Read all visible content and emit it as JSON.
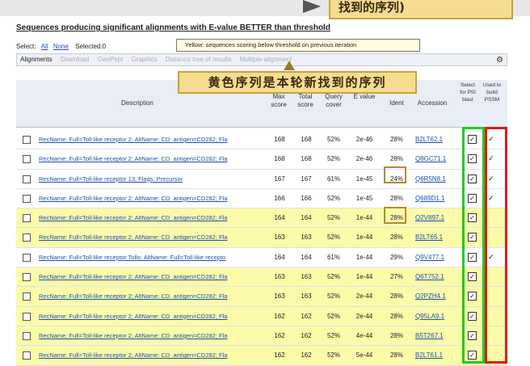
{
  "callout_top": "找到的序列)",
  "section_title": "Sequences producing significant alignments with E-value BETTER than threshold",
  "select": {
    "label": "Select:",
    "all": "All",
    "none": "None",
    "selected": "Selected:0"
  },
  "yellow_note": "Yellow: sequences scoring below threshold on previous iteration",
  "toolbar": {
    "alignments": "Alignments",
    "download": "Download",
    "genpept": "GenPept",
    "graphics": "Graphics",
    "distance": "Distance tree of results",
    "multiple": "Multiple alignment"
  },
  "callout_mid": "黄色序列是本轮新找到的序列",
  "headers": {
    "description": "Description",
    "max_score": "Max score",
    "total_score": "Total score",
    "query_cover": "Query cover",
    "e_value": "E value",
    "ident": "Ident",
    "accession": "Accession",
    "select_psi": "Select for PSI blast",
    "used_pssm": "Used to build PSSM"
  },
  "rows": [
    {
      "desc": "RecName: Full=Toll-like receptor 2; AltName: CD_antigen=CD282; Fla",
      "max": "168",
      "total": "168",
      "cover": "52%",
      "e": "2e-46",
      "ident": "28%",
      "acc": "B2LT62.1",
      "used": "✓",
      "hl": false
    },
    {
      "desc": "RecName: Full=Toll-like receptor 2; AltName: CD_antigen=CD282; Fla",
      "max": "168",
      "total": "168",
      "cover": "52%",
      "e": "2e-46",
      "ident": "28%",
      "acc": "Q8GC71.1",
      "used": "✓",
      "hl": false
    },
    {
      "desc": "RecName: Full=Toll-like receptor 13; Flags: Precursor",
      "max": "167",
      "total": "167",
      "cover": "61%",
      "e": "1e-45",
      "ident": "24%",
      "acc": "Q6R5N8.1",
      "used": "✓",
      "hl": false
    },
    {
      "desc": "RecName: Full=Toll-like receptor 2; AltName: CD_antigen=CD282; Fla",
      "max": "166",
      "total": "166",
      "cover": "52%",
      "e": "1e-45",
      "ident": "28%",
      "acc": "Q689D1.1",
      "used": "✓",
      "hl": false
    },
    {
      "desc": "RecName: Full=Toll-like receptor 2; AltName: CD_antigen=CD282; Fla",
      "max": "164",
      "total": "164",
      "cover": "52%",
      "e": "1e-44",
      "ident": "28%",
      "acc": "Q2V897.1",
      "used": "",
      "hl": true
    },
    {
      "desc": "RecName: Full=Toll-like receptor 2; AltName: CD_antigen=CD282; Fla",
      "max": "163",
      "total": "163",
      "cover": "52%",
      "e": "1e-44",
      "ident": "28%",
      "acc": "B2LT65.1",
      "used": "",
      "hl": true
    },
    {
      "desc": "RecName: Full=Toll-like receptor Tollo; AltName: Full=Toll-like recepto",
      "max": "164",
      "total": "164",
      "cover": "61%",
      "e": "1e-44",
      "ident": "29%",
      "acc": "Q9V477.1",
      "used": "✓",
      "hl": false
    },
    {
      "desc": "RecName: Full=Toll-like receptor 2; AltName: CD_antigen=CD282; Fla",
      "max": "163",
      "total": "163",
      "cover": "52%",
      "e": "1e-44",
      "ident": "27%",
      "acc": "Q6T752.1",
      "used": "",
      "hl": true
    },
    {
      "desc": "RecName: Full=Toll-like receptor 2; AltName: CD_antigen=CD282; Fla",
      "max": "163",
      "total": "163",
      "cover": "52%",
      "e": "2e-44",
      "ident": "28%",
      "acc": "Q2PZH4.1",
      "used": "",
      "hl": true
    },
    {
      "desc": "RecName: Full=Toll-like receptor 2; AltName: CD_antigen=CD282; Fla",
      "max": "162",
      "total": "162",
      "cover": "52%",
      "e": "2e-44",
      "ident": "28%",
      "acc": "Q95LA9.1",
      "used": "",
      "hl": true
    },
    {
      "desc": "RecName: Full=Toll-like receptor 2; AltName: CD_antigen=CD282; Fla",
      "max": "162",
      "total": "162",
      "cover": "52%",
      "e": "4e-44",
      "ident": "28%",
      "acc": "B5T267.1",
      "used": "",
      "hl": true
    },
    {
      "desc": "RecName: Full=Toll-like receptor 2; AltName: CD_antigen=CD282; Fla",
      "max": "162",
      "total": "162",
      "cover": "52%",
      "e": "5e-44",
      "ident": "28%",
      "acc": "B2LT61.1",
      "used": "",
      "hl": true
    }
  ],
  "select_check": "✓",
  "gear_icon": "⚙",
  "colors": {
    "highlight": "#fbfbaa",
    "green_box": "#22cc22",
    "red_box": "#dd1a1a",
    "link": "#2050b0"
  }
}
